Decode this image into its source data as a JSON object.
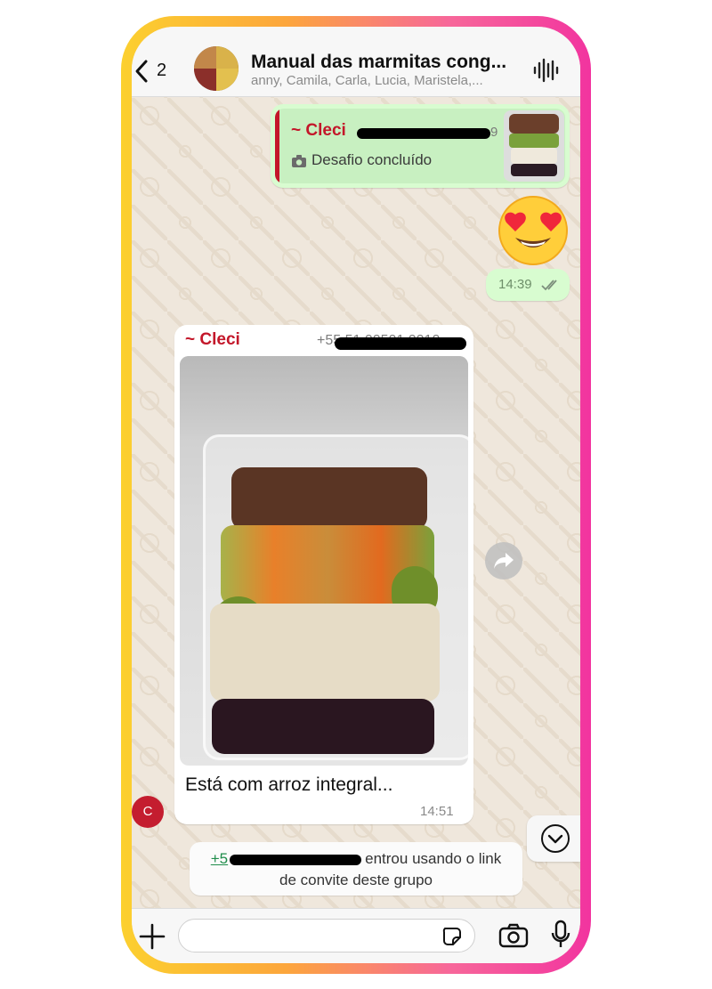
{
  "header": {
    "back_count": "2",
    "group_name": "Manual das marmitas cong...",
    "members": "anny, Camila, Carla, Lucia, Maristela,..."
  },
  "reply_bubble": {
    "sender": "~ Cleci",
    "phone_tail": "9",
    "quoted_text": "Desafio concluído",
    "quoted_icon": "camera-icon"
  },
  "sticker": {
    "icon": "heart-eyes-emoji"
  },
  "outgoing_time": {
    "time": "14:39",
    "status_icon": "double-check-icon"
  },
  "incoming_message": {
    "sender": "~ Cleci",
    "phone_prefix": "+55 51 00501 0010",
    "caption": "Está com arroz integral...",
    "time": "14:51",
    "avatar_letter": "C"
  },
  "system_message": {
    "phone_prefix": "+5",
    "line1_rest": "entrou usando o link",
    "line2": "de convite deste grupo"
  },
  "composer": {
    "placeholder": ""
  },
  "colors": {
    "outgoing_bubble": "#d8fcd0",
    "sender_name": "#c3172a",
    "link_green": "#1f8d4b",
    "avatar_red": "#c41d2f"
  }
}
